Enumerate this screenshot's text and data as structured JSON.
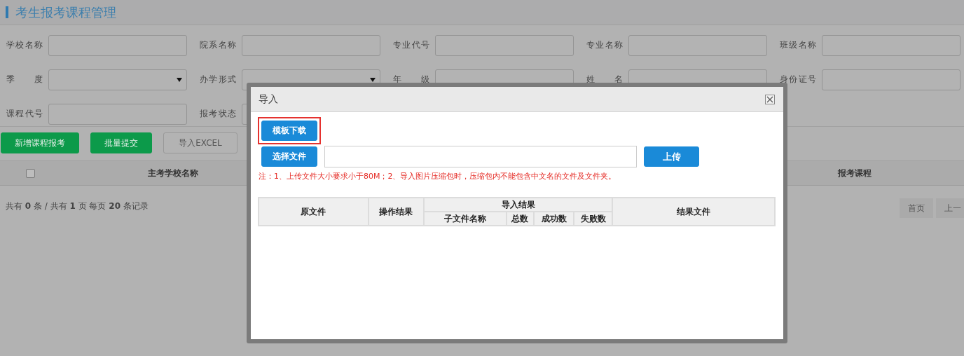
{
  "page": {
    "title": "考生报考课程管理"
  },
  "filters": [
    {
      "label": "学校名称",
      "kind": "text"
    },
    {
      "label": "院系名称",
      "kind": "text"
    },
    {
      "label": "专业代号",
      "kind": "text"
    },
    {
      "label": "专业名称",
      "kind": "text"
    },
    {
      "label": "班级名称",
      "kind": "text"
    },
    {
      "label": "季 度",
      "kind": "select"
    },
    {
      "label": "办学形式",
      "kind": "select"
    },
    {
      "label": "年 级",
      "kind": "text"
    },
    {
      "label": "姓 名",
      "kind": "text"
    },
    {
      "label": "身份证号",
      "kind": "text"
    },
    {
      "label": "课程代号",
      "kind": "text"
    },
    {
      "label": "报考状态",
      "kind": "text"
    }
  ],
  "toolbar": [
    {
      "label": "新增课程报考",
      "kind": "primary"
    },
    {
      "label": "批量提交",
      "kind": "primary"
    },
    {
      "label": "导入EXCEL",
      "kind": "default"
    }
  ],
  "table": {
    "columns": [
      {
        "kind": "checkbox",
        "checked": false
      },
      {
        "kind": "text",
        "label": "主考学校名称"
      },
      {
        "kind": "text",
        "label": "报考课程"
      }
    ]
  },
  "pager": {
    "summary": "共有 **0** 条 / 共有 **1** 页 每页 **20** 条记录",
    "buttons": [
      "首页",
      "上一"
    ]
  },
  "dialog": {
    "title": "导入",
    "template_button": {
      "label": "模板下载",
      "highlighted": true
    },
    "choose_button": {
      "label": "选择文件"
    },
    "upload_button": {
      "label": "上传"
    },
    "note": "注：1、上传文件大小要求小于80M；2、导入图片压缩包时，压缩包内不能包含中文名的文件及文件夹。",
    "result_table": {
      "columns": [
        {
          "label": "原文件"
        },
        {
          "label": "操作结果"
        },
        {
          "label": "导入结果",
          "children": [
            {
              "label": "子文件名称"
            },
            {
              "label": "总数"
            },
            {
              "label": "成功数"
            },
            {
              "label": "失败数"
            }
          ]
        },
        {
          "label": "结果文件"
        }
      ]
    }
  }
}
